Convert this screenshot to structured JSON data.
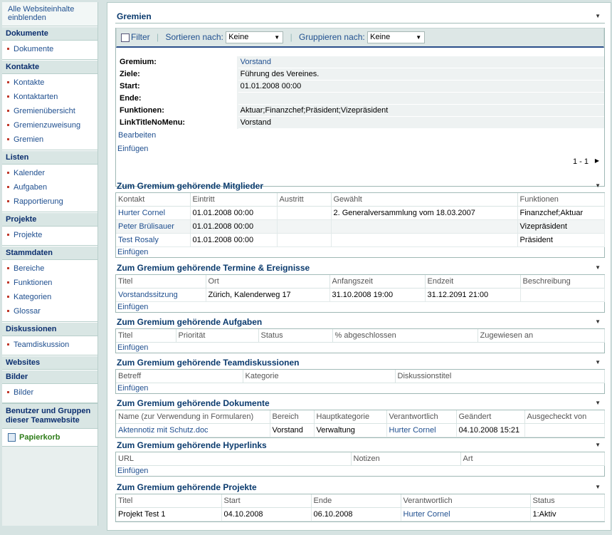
{
  "nav": {
    "top_link": "Alle Websiteinhalte einblenden",
    "sections": [
      {
        "title": "Dokumente",
        "items": [
          "Dokumente"
        ]
      },
      {
        "title": "Kontakte",
        "items": [
          "Kontakte",
          "Kontaktarten",
          "Gremienübersicht",
          "Gremienzuweisung",
          "Gremien"
        ]
      },
      {
        "title": "Listen",
        "items": [
          "Kalender",
          "Aufgaben",
          "Rapportierung"
        ]
      },
      {
        "title": "Projekte",
        "items": [
          "Projekte"
        ]
      },
      {
        "title": "Stammdaten",
        "items": [
          "Bereiche",
          "Funktionen",
          "Kategorien",
          "Glossar"
        ]
      },
      {
        "title": "Diskussionen",
        "items": [
          "Teamdiskussion"
        ]
      },
      {
        "title": "Websites",
        "items": []
      },
      {
        "title": "Bilder",
        "items": [
          "Bilder"
        ]
      }
    ],
    "users_groups": "Benutzer und Gruppen dieser Teamwebsite",
    "recycle": "Papierkorb"
  },
  "gremien": {
    "title": "Gremien",
    "toolbar": {
      "filter": "Filter",
      "sort_label": "Sortieren nach:",
      "sort_value": "Keine",
      "group_label": "Gruppieren nach:",
      "group_value": "Keine"
    },
    "fields": [
      {
        "label": "Gremium:",
        "value": "Vorstand",
        "link": true
      },
      {
        "label": "Ziele:",
        "value": "Führung des Vereines.",
        "link": false
      },
      {
        "label": "Start:",
        "value": "01.01.2008 00:00",
        "link": false
      },
      {
        "label": "Ende:",
        "value": "",
        "link": false
      },
      {
        "label": "Funktionen:",
        "value": "Aktuar;Finanzchef;Präsident;Vizepräsident",
        "link": false
      },
      {
        "label": "LinkTitleNoMenu:",
        "value": "Vorstand",
        "link": false
      }
    ],
    "edit_link": "Bearbeiten",
    "add_link": "Einfügen",
    "paging": "1 - 1"
  },
  "mitglieder": {
    "title": "Zum Gremium gehörende Mitglieder",
    "columns": [
      "Kontakt",
      "Eintritt",
      "Austritt",
      "Gewählt",
      "Funktionen"
    ],
    "rows": [
      [
        "Hurter Cornel",
        "01.01.2008 00:00",
        "",
        "2. Generalversammlung vom 18.03.2007",
        "Finanzchef;Aktuar"
      ],
      [
        "Peter Brülisauer",
        "01.01.2008 00:00",
        "",
        "",
        "Vizepräsident"
      ],
      [
        "Test Rosaly",
        "01.01.2008 00:00",
        "",
        "",
        "Präsident"
      ]
    ],
    "add_link": "Einfügen"
  },
  "termine": {
    "title": "Zum Gremium gehörende Termine & Ereignisse",
    "columns": [
      "Titel",
      "Ort",
      "Anfangszeit",
      "Endzeit",
      "Beschreibung"
    ],
    "rows": [
      [
        "Vorstandssitzung",
        "Zürich, Kalenderweg 17",
        "31.10.2008 19:00",
        "31.12.2091 21:00",
        ""
      ]
    ],
    "add_link": "Einfügen"
  },
  "aufgaben": {
    "title": "Zum Gremium gehörende Aufgaben",
    "columns": [
      "Titel",
      "Priorität",
      "Status",
      "% abgeschlossen",
      "Zugewiesen an"
    ],
    "add_link": "Einfügen"
  },
  "diskussionen": {
    "title": "Zum Gremium gehörende Teamdiskussionen",
    "columns": [
      "Betreff",
      "Kategorie",
      "Diskussionstitel"
    ],
    "add_link": "Einfügen"
  },
  "dokumente": {
    "title": "Zum Gremium gehörende Dokumente",
    "columns": [
      "Name (zur Verwendung in Formularen)",
      "Bereich",
      "Hauptkategorie",
      "Verantwortlich",
      "Geändert",
      "Ausgecheckt von"
    ],
    "rows": [
      [
        "Aktennotiz mit Schutz.doc",
        "Vorstand",
        "Verwaltung",
        "Hurter Cornel",
        "04.10.2008 15:21",
        ""
      ]
    ]
  },
  "hyperlinks": {
    "title": "Zum Gremium gehörende Hyperlinks",
    "columns": [
      "URL",
      "Notizen",
      "Art"
    ],
    "add_link": "Einfügen"
  },
  "projekte": {
    "title": "Zum Gremium gehörende Projekte",
    "columns": [
      "Titel",
      "Start",
      "Ende",
      "Verantwortlich",
      "Status"
    ],
    "rows": [
      [
        "Projekt Test 1",
        "04.10.2008",
        "06.10.2008",
        "Hurter Cornel",
        "1:Aktiv"
      ]
    ]
  }
}
